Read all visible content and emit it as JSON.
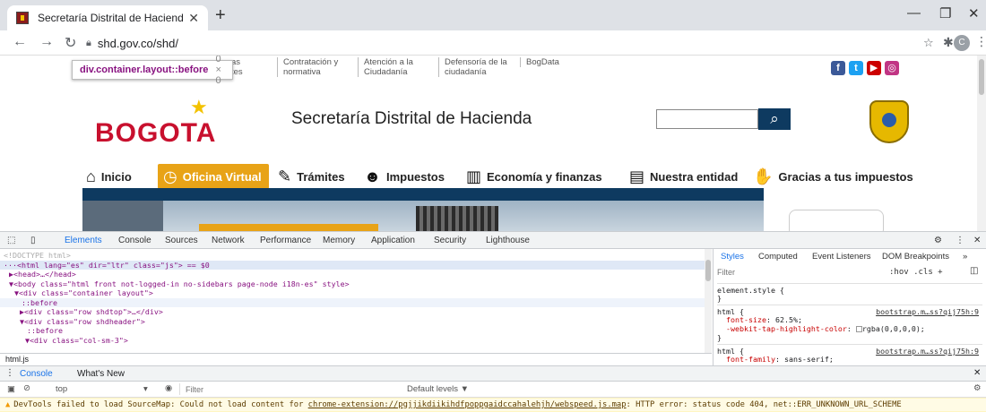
{
  "browser": {
    "tab_title": "Secretaría Distrital de Hacienda",
    "tab_close": "✕",
    "new_tab": "+",
    "url": "shd.gov.co/shd/",
    "avatar_letter": "C",
    "icons": [
      "back-icon",
      "forward-icon",
      "reload-icon",
      "lock-icon",
      "star-icon",
      "extensions-icon",
      "menu-icon"
    ]
  },
  "page": {
    "top_links": [
      "as\ntes",
      "Contratación y\nnormativa",
      "Atención a la\nCiudadanía",
      "Defensoría de la\nciudadanía",
      "BogData"
    ],
    "tooltip": {
      "selector": "div.container.layout::before",
      "dims": "0 × 0"
    },
    "logo_text": "BOGOTA",
    "site_title": "Secretaría Distrital de Hacienda",
    "search_placeholder": "",
    "social": [
      {
        "name": "facebook",
        "glyph": "f",
        "color": "#3b5998"
      },
      {
        "name": "twitter",
        "glyph": "t",
        "color": "#1da1f2"
      },
      {
        "name": "youtube",
        "glyph": "▶",
        "color": "#cc0000"
      },
      {
        "name": "instagram",
        "glyph": "◎",
        "color": "#c13584"
      }
    ],
    "nav": [
      {
        "label": "Inicio",
        "icon": "home-icon",
        "glyph": "⌂"
      },
      {
        "label": "Oficina Virtual",
        "icon": "clock-icon",
        "glyph": "◷"
      },
      {
        "label": "Trámites",
        "icon": "document-icon",
        "glyph": "✎"
      },
      {
        "label": "Impuestos",
        "icon": "people-icon",
        "glyph": "☻"
      },
      {
        "label": "Economía y finanzas",
        "icon": "chart-icon",
        "glyph": "▥"
      },
      {
        "label": "Nuestra entidad",
        "icon": "file-icon",
        "glyph": "▤"
      },
      {
        "label": "Gracias a tus impuestos",
        "icon": "thumbs-up-icon",
        "glyph": "✋"
      }
    ]
  },
  "devtools": {
    "tabs": [
      "Elements",
      "Console",
      "Sources",
      "Network",
      "Performance",
      "Memory",
      "Application",
      "Security",
      "Lighthouse"
    ],
    "dom_lines": [
      "<!DOCTYPE html>",
      "···<html lang=\"es\" dir=\"ltr\" class=\"js\"> == $0",
      "  ▶<head>…</head>",
      "  ▼<body class=\"html front not-logged-in no-sidebars page-node i18n-es\" style>",
      "    ▼<div class=\"container layout\">",
      "        ::before",
      "      ▶<div class=\"row shdtop\">…</div>",
      "      ▼<div class=\"row shdheader\">",
      "          ::before",
      "        ▼<div class=\"col-sm-3\">"
    ],
    "breadcrumb": "html.js",
    "styles_tabs": [
      "Styles",
      "Computed",
      "Event Listeners",
      "DOM Breakpoints",
      "»"
    ],
    "filter_placeholder": "Filter",
    "filter_tools": ":hov  .cls  +",
    "rules": [
      {
        "selector": "element.style {",
        "source": "",
        "props": []
      },
      {
        "selector": "html {",
        "source": "bootstrap.m…ss?qij75h:9",
        "props": [
          [
            "font-size",
            "62.5%;"
          ],
          [
            "-webkit-tap-highlight-color",
            "rgba(0,0,0,0);"
          ]
        ]
      },
      {
        "selector": "html {",
        "source": "bootstrap.m…ss?qij75h:9",
        "props": [
          [
            "font-family",
            "sans-serif;"
          ]
        ]
      }
    ],
    "drawer_tabs": [
      "Console",
      "What's New"
    ],
    "console_context": "top",
    "console_filter": "Filter",
    "levels": "Default levels ▼",
    "warning_prefix": "DevTools failed to load SourceMap: Could not load content for ",
    "warning_link": "chrome-extension://pgjjikdiikihdfpoppgaidccahalehjh/webspeed.js.map",
    "warning_suffix": ": HTTP error: status code 404, net::ERR_UNKNOWN_URL_SCHEME"
  }
}
